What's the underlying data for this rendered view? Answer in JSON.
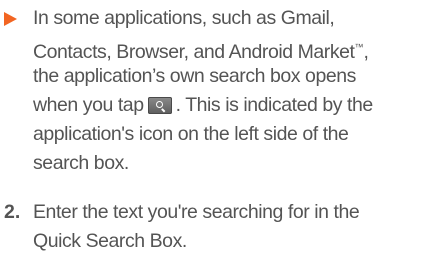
{
  "bullet": {
    "line1": "In some applications, such as Gmail,",
    "line2_pre": "Contacts, Browser, and Android Market",
    "line2_tm": "™",
    "line2_post": ",",
    "line3_pre": "the application’s own search box opens",
    "line4_pre": "when you tap",
    "line4_post": ". This is indicated by the",
    "line5": "application's icon on the left side of the",
    "line6": "search box.",
    "search_button_icon": "search-icon"
  },
  "step2": {
    "number": "2.",
    "line1": "Enter the text you're searching for in the",
    "line2": "Quick Search Box."
  },
  "colors": {
    "bullet_accent": "#f26522",
    "body_text": "#545454"
  }
}
